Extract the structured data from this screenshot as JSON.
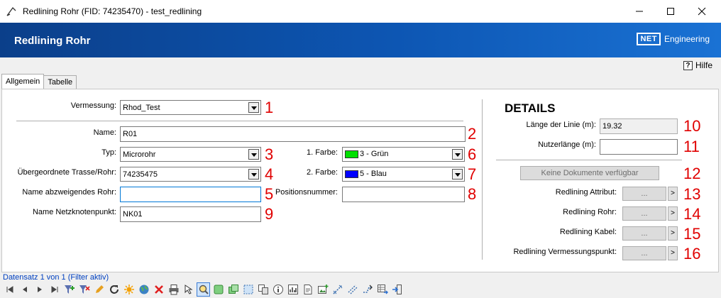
{
  "window": {
    "title": "Redlining Rohr (FID: 74235470) - test_redlining"
  },
  "banner": {
    "title": "Redlining Rohr",
    "logo_box": "NET",
    "logo_text": "Engineering"
  },
  "help": {
    "icon_char": "?",
    "label": "Hilfe"
  },
  "tabs": [
    {
      "label": "Allgemein",
      "active": true
    },
    {
      "label": "Tabelle",
      "active": false
    }
  ],
  "form": {
    "vermessung": {
      "label": "Vermessung:",
      "value": "Rhod_Test",
      "marker": "1"
    },
    "name": {
      "label": "Name:",
      "value": "R01",
      "marker": "2"
    },
    "typ": {
      "label": "Typ:",
      "value": "Microrohr",
      "marker": "3"
    },
    "trasse": {
      "label": "Übergeordnete Trasse/Rohr:",
      "value": "74235475",
      "marker": "4"
    },
    "abzweig": {
      "label": "Name abzweigendes Rohr:",
      "value": "",
      "marker": "5"
    },
    "netzknoten": {
      "label": "Name Netzknotenpunkt:",
      "value": "NK01",
      "marker": "9"
    },
    "farbe1": {
      "label": "1. Farbe:",
      "value": "3 - Grün",
      "color": "#00e000",
      "marker": "6"
    },
    "farbe2": {
      "label": "2. Farbe:",
      "value": "5 - Blau",
      "color": "#0000ff",
      "marker": "7"
    },
    "position": {
      "label": "Positionsnummer:",
      "value": "",
      "marker": "8"
    }
  },
  "details": {
    "title": "DETAILS",
    "laenge": {
      "label": "Länge der Linie (m):",
      "value": "19.32",
      "marker": "10"
    },
    "nutzer": {
      "label": "Nutzerlänge (m):",
      "value": "",
      "marker": "11"
    },
    "dokumente": {
      "label": "Keine Dokumente verfügbar",
      "marker": "12"
    },
    "links": [
      {
        "label": "Redlining Attribut:",
        "btn": "...",
        "go": ">",
        "marker": "13"
      },
      {
        "label": "Redlining Rohr:",
        "btn": "...",
        "go": ">",
        "marker": "14"
      },
      {
        "label": "Redlining Kabel:",
        "btn": "...",
        "go": ">",
        "marker": "15"
      },
      {
        "label": "Redlining Vermessungspunkt:",
        "btn": "...",
        "go": ">",
        "marker": "16"
      }
    ]
  },
  "status": {
    "text": "Datensatz 1 von 1 (Filter aktiv)"
  },
  "toolbar_icons": [
    "first-record-icon",
    "prev-record-icon",
    "next-record-icon",
    "last-record-icon",
    "add-filter-icon",
    "remove-filter-icon",
    "edit-icon",
    "refresh-icon",
    "highlight-icon",
    "globe-icon",
    "delete-icon",
    "print-icon",
    "select-tool-icon",
    "zoom-icon",
    "map-layer-icon",
    "map-copy-icon",
    "select-area-icon",
    "copy-icon",
    "info-icon",
    "chart-icon",
    "document-icon",
    "image-add-icon",
    "dimension-icon",
    "line-dashed-icon",
    "route-icon",
    "table-export-icon",
    "exit-icon"
  ]
}
